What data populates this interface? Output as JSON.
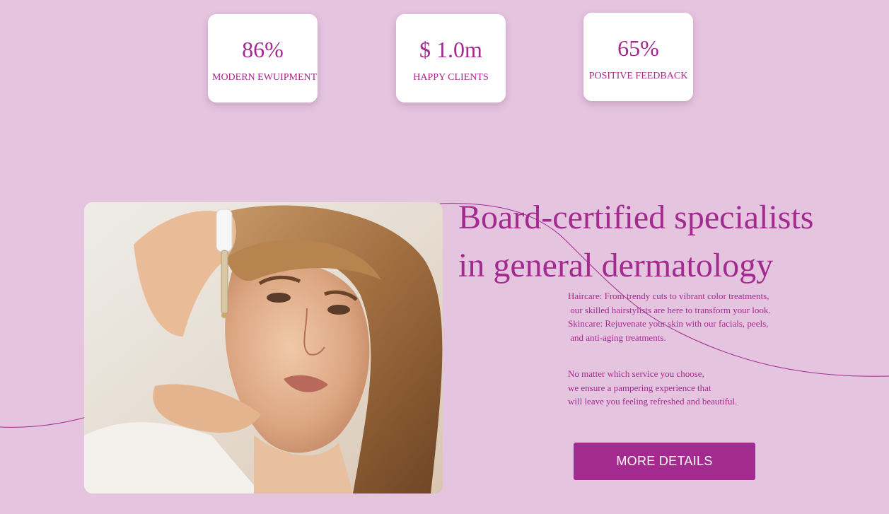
{
  "stats": [
    {
      "value": "86%",
      "label": "MODERN EWUIPMENT"
    },
    {
      "value": "$ 1.0m",
      "label": "HAPPY CLIENTS"
    },
    {
      "value": "65%",
      "label": "POSITIVE FEEDBACK"
    }
  ],
  "hero": {
    "headline_line1": "Board-certified specialists",
    "headline_line2": "in general dermatology",
    "paragraph1": "Haircare: From trendy cuts to vibrant color treatments,\n our skilled hairstylists are here to transform your look.\nSkincare: Rejuvenate your skin with our facials, peels,\n and anti-aging treatments.",
    "paragraph2": "No matter which service you choose,\nwe ensure a pampering experience that\nwill leave you feeling refreshed and beautiful.",
    "cta_label": "MORE DETAILS"
  },
  "colors": {
    "background": "#e5c4e0",
    "accent": "#a32a8e",
    "card": "#ffffff"
  },
  "photo": {
    "subject": "woman-applying-serum-dropper"
  }
}
